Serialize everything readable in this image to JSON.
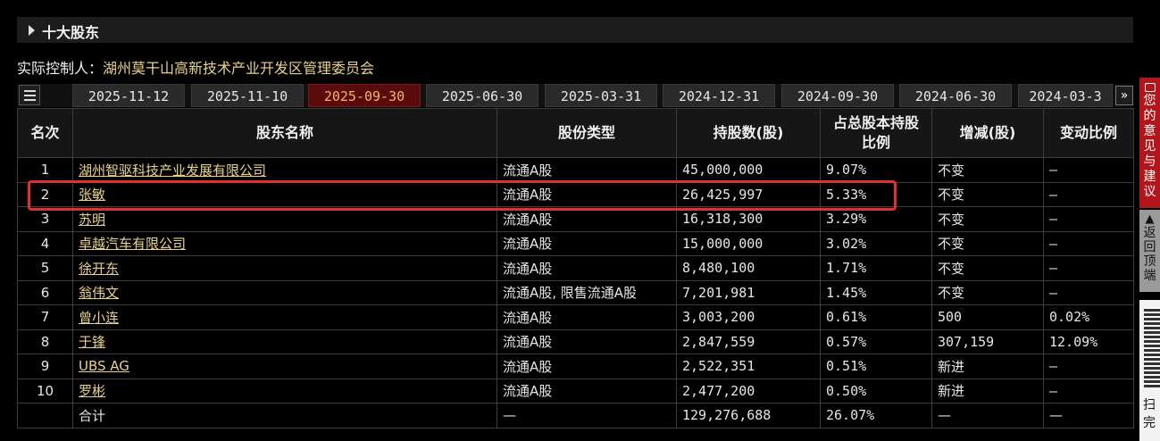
{
  "section": {
    "title": "十大股东"
  },
  "controller": {
    "label": "实际控制人：",
    "value": "湖州莫干山高新技术产业开发区管理委员会"
  },
  "tabs": [
    "2025-11-12",
    "2025-11-10",
    "2025-09-30",
    "2025-06-30",
    "2025-03-31",
    "2024-12-31",
    "2024-09-30",
    "2024-06-30",
    "2024-03-3"
  ],
  "active_tab_index": 2,
  "table": {
    "headers": {
      "rank": "名次",
      "name": "股东名称",
      "type": "股份类型",
      "shares": "持股数(股)",
      "ratio": "占总股本持股比例",
      "change": "增减(股)",
      "change_ratio": "变动比例"
    },
    "rows": [
      {
        "rank": "1",
        "name": "湖州智驱科技产业发展有限公司",
        "type": "流通A股",
        "shares": "45,000,000",
        "ratio": "9.07%",
        "change": "不变",
        "change_ratio": "—"
      },
      {
        "rank": "2",
        "name": "张敏",
        "type": "流通A股",
        "shares": "26,425,997",
        "ratio": "5.33%",
        "change": "不变",
        "change_ratio": "—"
      },
      {
        "rank": "3",
        "name": "苏明",
        "type": "流通A股",
        "shares": "16,318,300",
        "ratio": "3.29%",
        "change": "不变",
        "change_ratio": "—"
      },
      {
        "rank": "4",
        "name": "卓越汽车有限公司",
        "type": "流通A股",
        "shares": "15,000,000",
        "ratio": "3.02%",
        "change": "不变",
        "change_ratio": "—"
      },
      {
        "rank": "5",
        "name": "徐开东",
        "type": "流通A股",
        "shares": "8,480,100",
        "ratio": "1.71%",
        "change": "不变",
        "change_ratio": "—"
      },
      {
        "rank": "6",
        "name": "翁伟文",
        "type": "流通A股, 限售流通A股",
        "shares": "7,201,981",
        "ratio": "1.45%",
        "change": "不变",
        "change_ratio": "—"
      },
      {
        "rank": "7",
        "name": "曾小连",
        "type": "流通A股",
        "shares": "3,003,200",
        "ratio": "0.61%",
        "change": "500",
        "change_ratio": "0.02%"
      },
      {
        "rank": "8",
        "name": "于锋",
        "type": "流通A股",
        "shares": "2,847,559",
        "ratio": "0.57%",
        "change": "307,159",
        "change_ratio": "12.09%"
      },
      {
        "rank": "9",
        "name": "UBS AG",
        "type": "流通A股",
        "shares": "2,522,351",
        "ratio": "0.51%",
        "change": "新进",
        "change_ratio": "—"
      },
      {
        "rank": "10",
        "name": "罗彬",
        "type": "流通A股",
        "shares": "2,477,200",
        "ratio": "0.50%",
        "change": "新进",
        "change_ratio": "—"
      }
    ],
    "total": {
      "label": "合计",
      "type": "—",
      "shares": "129,276,688",
      "ratio": "26.07%",
      "change": "—",
      "change_ratio": "—"
    }
  },
  "side": {
    "feedback": "您的意见与建议",
    "back_to_top": "返回顶端",
    "scan": "扫\n完"
  },
  "colors": {
    "accent_red": "#ff3b3b",
    "name_link": "#e8d28a",
    "active_tab_bg": "#5a0b0b",
    "active_tab_text": "#ffb060",
    "highlight": "#e03131"
  }
}
